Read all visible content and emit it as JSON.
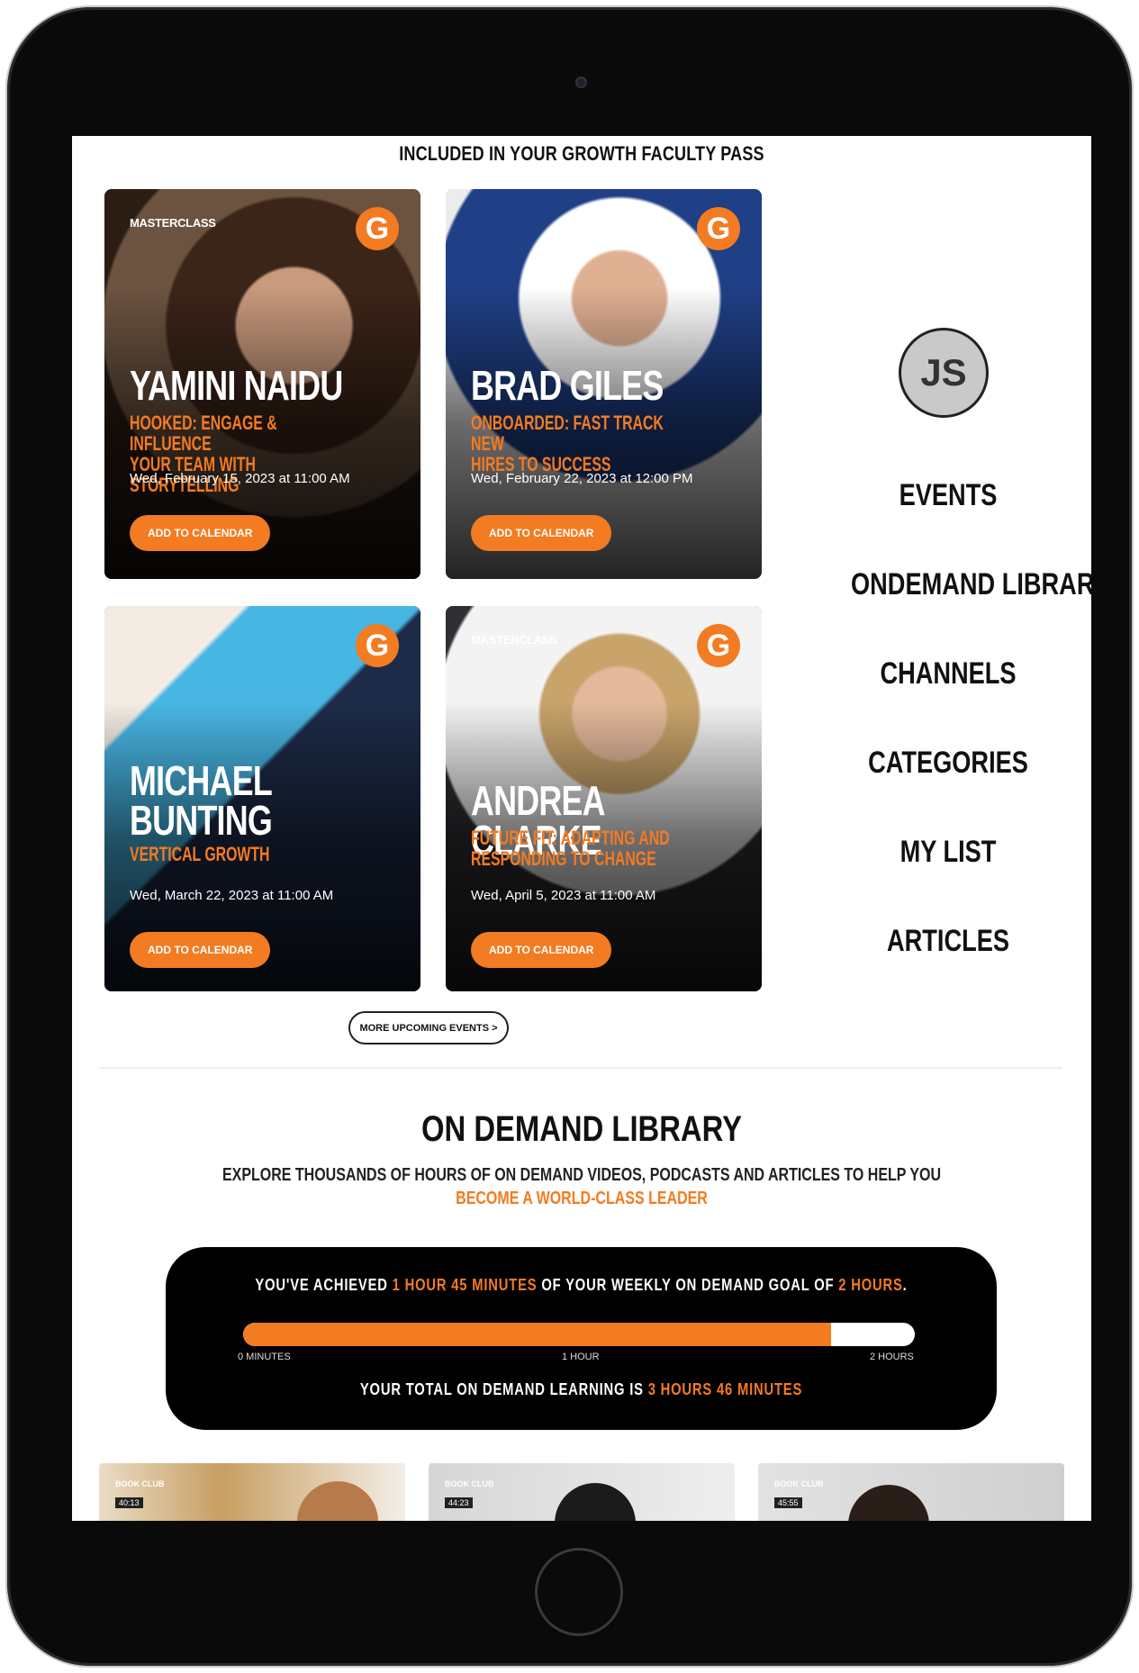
{
  "pass_title": "INCLUDED IN YOUR GROWTH FACULTY PASS",
  "cards": [
    {
      "badge": "MASTERCLASS",
      "logo": "G",
      "speaker": "YAMINI NAIDU",
      "talk": "HOOKED: ENGAGE & INFLUENCE\nYOUR TEAM WITH STORYTELLING",
      "date": "Wed, February 15, 2023 at 11:00 AM",
      "button": "ADD TO CALENDAR"
    },
    {
      "badge": "",
      "logo": "G",
      "speaker": "BRAD GILES",
      "talk": "ONBOARDED: FAST TRACK NEW\nHIRES TO SUCCESS",
      "date": "Wed, February 22, 2023 at 12:00 PM",
      "button": "ADD TO CALENDAR"
    },
    {
      "badge": "",
      "logo": "G",
      "speaker": "MICHAEL\nBUNTING",
      "talk": "VERTICAL GROWTH",
      "date": "Wed, March 22, 2023 at 11:00 AM",
      "button": "ADD TO CALENDAR"
    },
    {
      "badge": "MASTERCLASS",
      "logo": "G",
      "speaker": "ANDREA CLARKE",
      "talk": "FUTURE FIT: ADAPTING AND\nRESPONDING TO CHANGE",
      "date": "Wed, April 5, 2023 at 11:00 AM",
      "button": "ADD TO CALENDAR"
    }
  ],
  "more_events": "MORE UPCOMING EVENTS >",
  "user": {
    "initials": "JS"
  },
  "nav": [
    "EVENTS",
    "ONDEMAND LIBRARY",
    "CHANNELS",
    "CATEGORIES",
    "MY LIST",
    "ARTICLES"
  ],
  "on_demand": {
    "title": "ON DEMAND LIBRARY",
    "subtitle_line1": "EXPLORE THOUSANDS OF HOURS OF ON DEMAND VIDEOS, PODCASTS AND ARTICLES TO HELP YOU",
    "subtitle_line2": "BECOME A WORLD-CLASS LEADER"
  },
  "goal": {
    "prefix": "YOU'VE ACHIEVED ",
    "achieved": "1 HOUR 45 MINUTES",
    "middle": " OF YOUR WEEKLY ON DEMAND GOAL OF ",
    "target": "2 HOURS",
    "suffix": ".",
    "progress": 0.875,
    "tick_start": "0 MINUTES",
    "tick_mid": "1 HOUR",
    "tick_end": "2 HOURS",
    "total_prefix": "YOUR TOTAL ON DEMAND LEARNING IS ",
    "total_value": "3 HOURS 46 MINUTES"
  },
  "thumbnails": [
    {
      "tag": "BOOK CLUB",
      "duration": "40:13"
    },
    {
      "tag": "BOOK CLUB",
      "duration": "44:23"
    },
    {
      "tag": "BOOK CLUB",
      "duration": "45:55"
    }
  ],
  "colors": {
    "accent": "#f37b21",
    "frame": "#0a0a0a"
  }
}
